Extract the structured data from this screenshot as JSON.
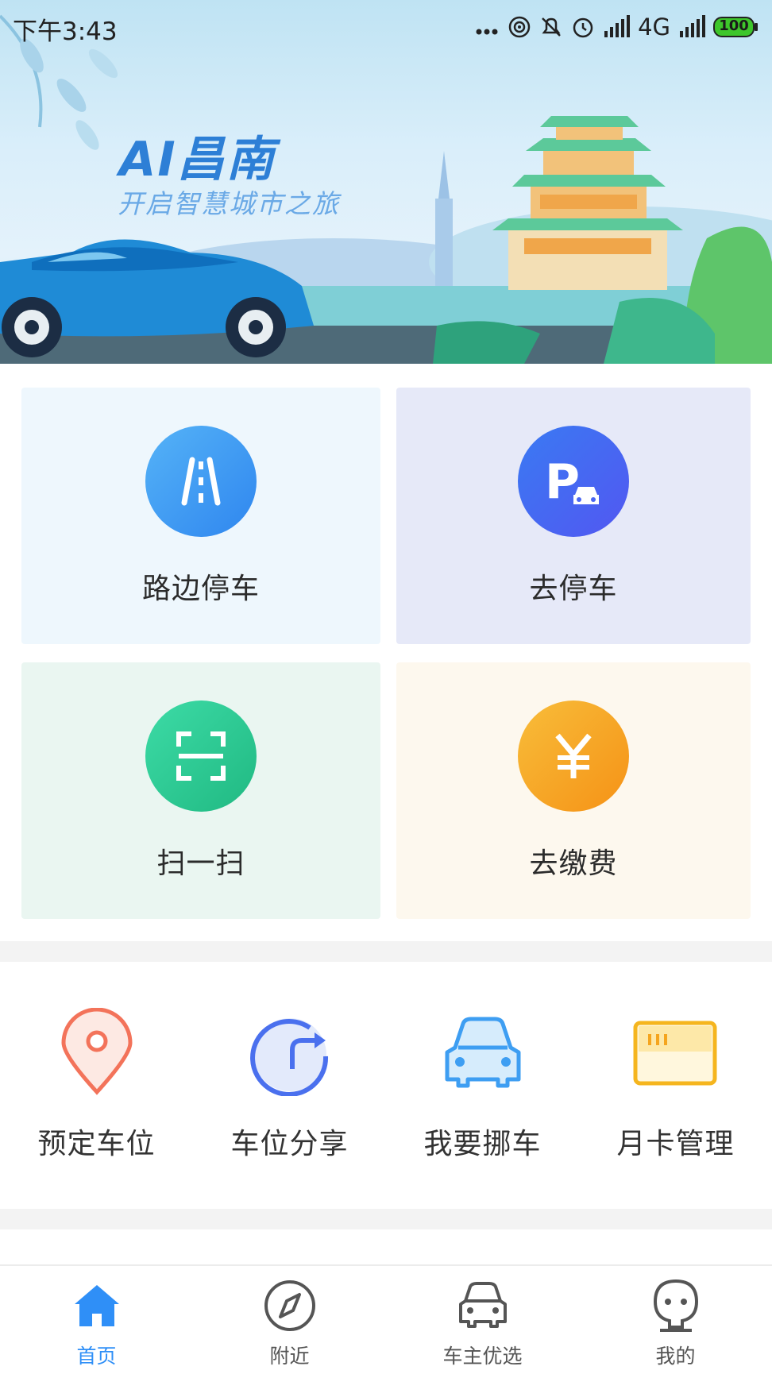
{
  "status_bar": {
    "time": "下午3:43",
    "network": "4G",
    "battery": "100"
  },
  "banner": {
    "title": "AI昌南",
    "subtitle": "开启智慧城市之旅"
  },
  "tiles": [
    {
      "label": "路边停车",
      "icon": "road-icon",
      "bg": "#eef7fd",
      "icon_color": "#3c9cf3"
    },
    {
      "label": "去停车",
      "icon": "parking-car-icon",
      "bg": "#e6e9f8",
      "icon_color": "#4169f0"
    },
    {
      "label": "扫一扫",
      "icon": "scan-icon",
      "bg": "#eaf6f1",
      "icon_color": "#25c48f"
    },
    {
      "label": "去缴费",
      "icon": "yuan-icon",
      "bg": "#fdf8ee",
      "icon_color": "#f4a020"
    }
  ],
  "quick_actions": [
    {
      "label": "预定车位",
      "icon": "location-pin-icon"
    },
    {
      "label": "车位分享",
      "icon": "share-refresh-icon"
    },
    {
      "label": "我要挪车",
      "icon": "car-front-icon"
    },
    {
      "label": "月卡管理",
      "icon": "card-icon"
    }
  ],
  "bottom_nav": {
    "active": "首页",
    "items": [
      {
        "label": "首页",
        "icon": "home-icon"
      },
      {
        "label": "附近",
        "icon": "compass-icon"
      },
      {
        "label": "车主优选",
        "icon": "car-icon"
      },
      {
        "label": "我的",
        "icon": "person-icon"
      }
    ]
  },
  "colors": {
    "accent": "#2f8ff7",
    "separator": "#f3f3f3"
  }
}
